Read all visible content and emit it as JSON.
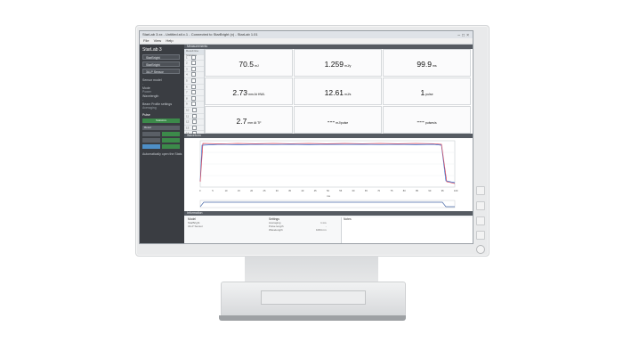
{
  "window": {
    "title": "StarLab 3.xx - Untitled.stl.x.1 - Connected to StarBright (x) - StarLab 1.01",
    "controls": "–□×"
  },
  "menu": [
    "File",
    "View",
    "Help"
  ],
  "sidebar": {
    "title": "StarLab 3",
    "devices": [
      "StarBright",
      "StarBright",
      "3A-P Sensor"
    ],
    "labels": [
      "Sensor model",
      "Mode",
      "Wavelength",
      "Beam Profile settings"
    ],
    "values": [
      "-",
      "Power",
      "-",
      "Averaging"
    ],
    "section": "Pulse",
    "stats_button": "Statistics",
    "reset_button": "Reset",
    "checkbox_label": "Automatically open the Stats"
  },
  "measurements": {
    "header": "Measurements",
    "list_header": "Result line   Statistics",
    "rows": [
      "1",
      "2",
      "3",
      "4",
      "5",
      "6",
      "7",
      "8",
      "9",
      "10",
      "11",
      "12",
      "13",
      "14",
      "15"
    ],
    "cells": [
      {
        "value": "70.5",
        "unit": "mJ"
      },
      {
        "value": "1.259",
        "unit": "mJ/y"
      },
      {
        "value": "99.9",
        "unit": "ms"
      },
      {
        "value": "2.73",
        "unit": "mm At HWL"
      },
      {
        "value": "12.61",
        "unit": "mJ/s"
      },
      {
        "value": "1",
        "unit": "pulse"
      },
      {
        "value": "2.7",
        "unit": "mm At TF"
      },
      {
        "value": "---",
        "unit": "mJ/pulse"
      },
      {
        "value": "---",
        "unit": "pulses/s"
      }
    ]
  },
  "waveform": {
    "header": "Waveform",
    "x_ticks": [
      "0",
      "5",
      "10",
      "15",
      "20",
      "25",
      "30",
      "35",
      "40",
      "45",
      "50",
      "55",
      "60",
      "65",
      "70",
      "75",
      "80",
      "85",
      "90",
      "95",
      "100"
    ],
    "x_label": "ms",
    "colors": {
      "series1": "#2f6fd0",
      "series2": "#d6455a",
      "lower": "#4a6aa8"
    }
  },
  "information": {
    "header": "Information",
    "col1": {
      "head": "Model",
      "items": [
        "StarBright",
        "3A-P Sensor"
      ]
    },
    "col2": {
      "head": "Settings",
      "items": [
        "Averaging",
        "Pulse length",
        "Wavelength"
      ],
      "values": [
        "1 ms",
        "-",
        "1064 nm"
      ]
    },
    "col3": {
      "head": "Notes"
    }
  }
}
